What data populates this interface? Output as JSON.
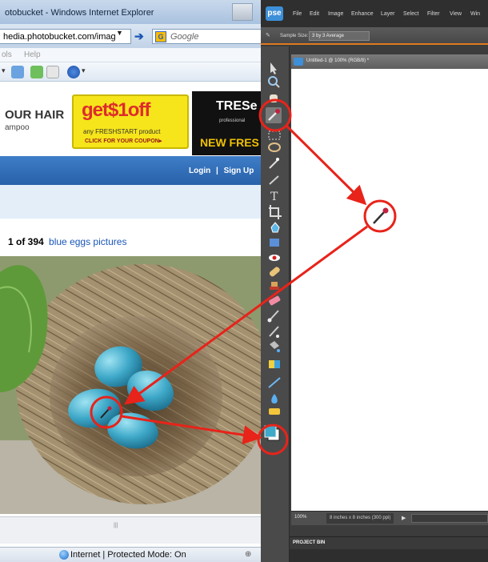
{
  "ie": {
    "window_title": "otobucket - Windows Internet Explorer",
    "address_value": "hedia.photobucket.com/imag",
    "search_placeholder": "Google",
    "menu_partial": [
      "ols",
      "Help"
    ],
    "ad": {
      "headline": "OUR HAIR",
      "subline": "ampoo",
      "coupon_big": "get$1off",
      "coupon_line1": "any FRESHSTART product",
      "coupon_line2": "CLICK FOR YOUR COUPON▸",
      "brand": "TRESe",
      "brand_sub": "professional",
      "brand_tag": "NEW FRES"
    },
    "nav": {
      "login": "Login",
      "separator": "|",
      "signup": "Sign Up"
    },
    "result_count": "1 of 394",
    "result_link": "blue eggs pictures",
    "status_text": "Internet | Protected Mode: On",
    "status_zoom": "⊕"
  },
  "pse": {
    "logo": "pse",
    "menu": [
      "File",
      "Edit",
      "Image",
      "Enhance",
      "Layer",
      "Select",
      "Filter",
      "View",
      "Win"
    ],
    "options_label": "Sample Size:",
    "options_value": "3 by 3 Average",
    "doc_title": "Untitled-1 @ 100% (RGB/8) *",
    "zoom": "100%",
    "doc_info": "8 inches x 8 inches (300 ppi)",
    "panel": "PROJECT BIN"
  },
  "colors": {
    "annotation_red": "#e8231a",
    "egg_blue": "#3fa9c9",
    "pse_accent": "#e07a1e"
  },
  "icons": {
    "eyedropper": "eyedropper-icon",
    "foreground_background_swatch": "color-swatch-icon",
    "globe": "globe-icon"
  }
}
